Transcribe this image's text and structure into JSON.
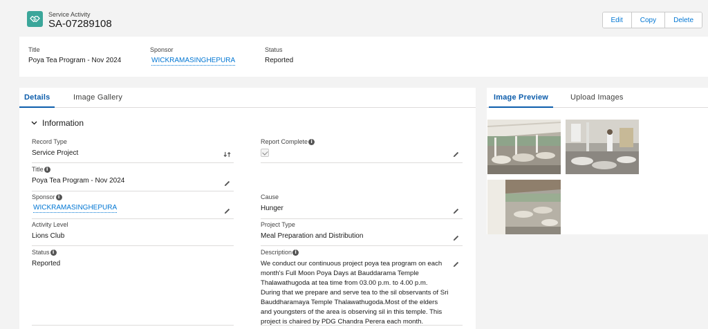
{
  "header": {
    "object_type": "Service Activity",
    "record_name": "SA-07289108",
    "buttons": [
      "Edit",
      "Copy",
      "Delete"
    ],
    "icon": "handshake-icon",
    "icon_color": "#3ba69a"
  },
  "highlights": {
    "title_label": "Title",
    "title_value": "Poya Tea Program - Nov 2024",
    "sponsor_label": "Sponsor",
    "sponsor_value": "WICKRAMASINGHEPURA",
    "status_label": "Status",
    "status_value": "Reported"
  },
  "main_tabs": [
    "Details",
    "Image Gallery"
  ],
  "section": {
    "title": "Information"
  },
  "fields": {
    "record_type": {
      "label": "Record Type",
      "value": "Service Project"
    },
    "report_complete": {
      "label": "Report Complete",
      "checked": true
    },
    "title": {
      "label": "Title",
      "value": "Poya Tea Program - Nov 2024"
    },
    "sponsor": {
      "label": "Sponsor",
      "value": "WICKRAMASINGHEPURA"
    },
    "cause": {
      "label": "Cause",
      "value": "Hunger"
    },
    "activity_level": {
      "label": "Activity Level",
      "value": "Lions Club"
    },
    "project_type": {
      "label": "Project Type",
      "value": "Meal Preparation and Distribution"
    },
    "status": {
      "label": "Status",
      "value": "Reported"
    },
    "description": {
      "label": "Description",
      "value": "We conduct our continuous project poya tea program on each month's Full Moon Poya Days at Bauddarama Temple Thalawathugoda at tea time from 03.00 p.m. to 4.00 p.m. During that we prepare and serve tea to the sil observants of Sri Bauddharamaya Temple Thalawathugoda.Most of the elders and youngsters of the area is observing sil in this temple. This project is chaired by PDG Chandra Perera each month."
    }
  },
  "preview_tabs": [
    "Image Preview",
    "Upload Images"
  ],
  "colors": {
    "accent": "#0b5cab",
    "link": "#0176d3"
  }
}
